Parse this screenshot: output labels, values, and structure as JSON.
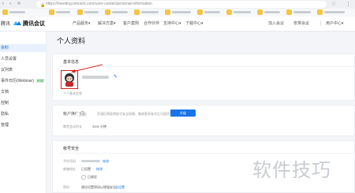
{
  "browser": {
    "url": "https://meeting.tencent.com/user-center/personal-information",
    "back_glyph": "‹",
    "forward_glyph": "›",
    "reload_glyph": "⟳",
    "lock_glyph": "🔒",
    "star_glyph": "☆",
    "menu_glyph": "⋮"
  },
  "header": {
    "brand_prefix": "腾讯",
    "brand_name": "腾讯会议",
    "nav": [
      "产品服务",
      "解决方案",
      "客户案例",
      "合作伙伴",
      "支持中心",
      "下载中心"
    ],
    "right_items": [
      "加入会议",
      "安排会议",
      "用户中心"
    ],
    "chevron": "▾",
    "brand_color": "#1a73e8"
  },
  "sidebar": {
    "items": [
      {
        "label": "资料",
        "active": true
      },
      {
        "label": "人员设置",
        "active": false
      },
      {
        "label": "议列表",
        "active": false
      },
      {
        "label": "事件日历(Webinar)",
        "active": false,
        "badge": "新增"
      },
      {
        "label": "文档",
        "active": false
      },
      {
        "label": "控制",
        "active": false
      },
      {
        "label": "隐私",
        "active": false
      },
      {
        "label": "管理",
        "active": false
      }
    ]
  },
  "main": {
    "page_title": "个人资料",
    "basic_info": {
      "title": "基本信息",
      "edit_icon": "✎",
      "avatar_caption": "个人基本信息"
    },
    "account_binding": {
      "label": "帐户换绑",
      "toggle_text": "开关",
      "hint": "开通后将获得账号安全保障，解绑更多账号后可使用",
      "button": "升级",
      "quota_label": "剩余会议时长",
      "quota_value": "3000 分钟"
    },
    "account_security": {
      "title": "帐号安全",
      "rows": [
        {
          "label": "手机号码",
          "value": "",
          "link": "修改"
        },
        {
          "label": "邮箱地址",
          "value": "已设置",
          "link": "修改"
        },
        {
          "label": "",
          "value": "已绑定",
          "link": ""
        },
        {
          "label": "密码",
          "value": "建议设置密码以增强安全",
          "link": "去设置"
        }
      ]
    }
  },
  "watermark": "软件技巧"
}
